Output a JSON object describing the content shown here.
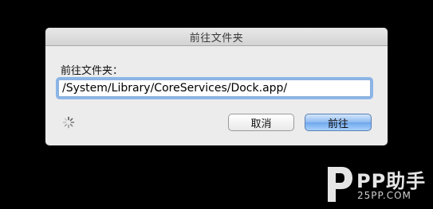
{
  "dialog": {
    "title": "前往文件夹",
    "prompt": "前往文件夹：",
    "path_value": "/System/Library/CoreServices/Dock.app/",
    "cancel_label": "取消",
    "go_label": "前往"
  },
  "watermark": {
    "brand": "PP助手",
    "url": "25PP.COM"
  },
  "colors": {
    "background": "#000000",
    "dialog": "#ececec",
    "focus_ring": "#8ab5e8",
    "default_button": "#8dbaf0"
  },
  "icons": {
    "spinner": "progress-spinner-icon",
    "logo": "pp-logo-icon"
  }
}
